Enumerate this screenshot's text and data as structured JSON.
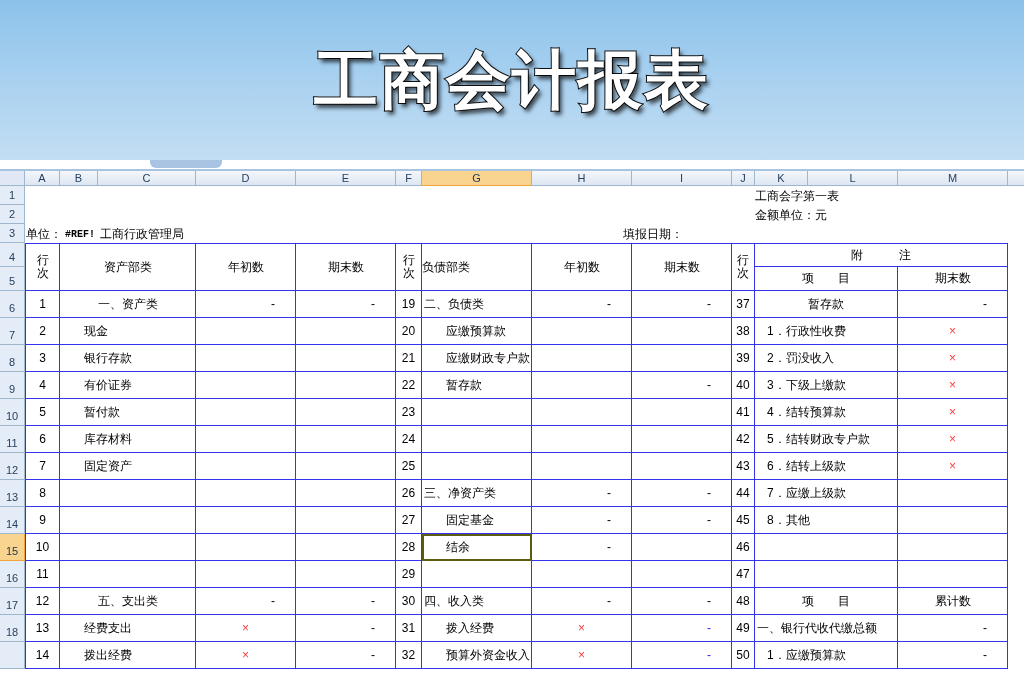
{
  "banner": {
    "title": "工商会计报表"
  },
  "columns": [
    {
      "label": "A",
      "selected": false
    },
    {
      "label": "B",
      "selected": false
    },
    {
      "label": "C",
      "selected": false
    },
    {
      "label": "D",
      "selected": false
    },
    {
      "label": "E",
      "selected": false
    },
    {
      "label": "F",
      "selected": false
    },
    {
      "label": "G",
      "selected": true
    },
    {
      "label": "H",
      "selected": false
    },
    {
      "label": "I",
      "selected": false
    },
    {
      "label": "J",
      "selected": false
    },
    {
      "label": "K",
      "selected": false
    },
    {
      "label": "L",
      "selected": false
    },
    {
      "label": "M",
      "selected": false
    }
  ],
  "row_headers": [
    {
      "label": "1",
      "selected": false
    },
    {
      "label": "2",
      "selected": false
    },
    {
      "label": "3",
      "selected": false
    },
    {
      "label": "4",
      "selected": false
    },
    {
      "label": "5",
      "selected": false
    },
    {
      "label": "6",
      "selected": false
    },
    {
      "label": "7",
      "selected": false
    },
    {
      "label": "8",
      "selected": false
    },
    {
      "label": "9",
      "selected": false
    },
    {
      "label": "10",
      "selected": false
    },
    {
      "label": "11",
      "selected": false
    },
    {
      "label": "12",
      "selected": false
    },
    {
      "label": "13",
      "selected": false
    },
    {
      "label": "14",
      "selected": false
    },
    {
      "label": "15",
      "selected": true
    },
    {
      "label": "16",
      "selected": false
    },
    {
      "label": "17",
      "selected": false
    },
    {
      "label": "18",
      "selected": false
    }
  ],
  "form_code": "工商会字第一表",
  "amount_unit": "金额单位：元",
  "report_date": "填报日期：",
  "unit_label": "单位：",
  "unit_ref": "#REF!",
  "unit_name": "工商行政管理局",
  "headers": {
    "left_no": "行次",
    "left_item": "资产部类",
    "left_start": "年初数",
    "left_end": "期末数",
    "middle_no": "行次",
    "middle_item": "负债部类",
    "middle_start": "年初数",
    "middle_end": "期末数",
    "right_no": "行次",
    "notes": "附　　　注",
    "right_item": "项　　目",
    "right_value": "期末数"
  },
  "rows": [
    {
      "left": {
        "no": "1",
        "item": {
          "text": "一、资产类",
          "kind": "heading"
        },
        "start": {
          "text": "-",
          "kind": "number"
        },
        "end": {
          "text": "-",
          "kind": "number"
        }
      },
      "middle": {
        "no": "19",
        "item": {
          "text": "二、负债类",
          "kind": "section"
        },
        "start": {
          "text": "-",
          "kind": "number"
        },
        "end": {
          "text": "-",
          "kind": "number"
        }
      },
      "right": {
        "no": "37",
        "item": {
          "text": "暂存款",
          "kind": "heading"
        },
        "value": {
          "text": "-",
          "kind": "number"
        }
      }
    },
    {
      "left": {
        "no": "2",
        "item": {
          "text": "现金",
          "kind": "item"
        }
      },
      "middle": {
        "no": "20",
        "item": {
          "text": "应缴预算款",
          "kind": "item"
        }
      },
      "right": {
        "no": "38",
        "item": {
          "text": "1．行政性收费",
          "kind": "item"
        },
        "value": {
          "text": "×",
          "kind": "error"
        }
      }
    },
    {
      "left": {
        "no": "3",
        "item": {
          "text": "银行存款",
          "kind": "item"
        }
      },
      "middle": {
        "no": "21",
        "item": {
          "text": "应缴财政专户款",
          "kind": "item"
        }
      },
      "right": {
        "no": "39",
        "item": {
          "text": "2．罚没收入",
          "kind": "item"
        },
        "value": {
          "text": "×",
          "kind": "error"
        }
      }
    },
    {
      "left": {
        "no": "4",
        "item": {
          "text": "有价证券",
          "kind": "item"
        }
      },
      "middle": {
        "no": "22",
        "item": {
          "text": "暂存款",
          "kind": "item"
        },
        "end": {
          "text": "-",
          "kind": "number"
        }
      },
      "right": {
        "no": "40",
        "item": {
          "text": "3．下级上缴款",
          "kind": "item"
        },
        "value": {
          "text": "×",
          "kind": "error"
        }
      }
    },
    {
      "left": {
        "no": "5",
        "item": {
          "text": "暂付款",
          "kind": "item"
        }
      },
      "middle": {
        "no": "23"
      },
      "right": {
        "no": "41",
        "item": {
          "text": "4．结转预算款",
          "kind": "item"
        },
        "value": {
          "text": "×",
          "kind": "error"
        }
      }
    },
    {
      "left": {
        "no": "6",
        "item": {
          "text": "库存材料",
          "kind": "item"
        }
      },
      "middle": {
        "no": "24"
      },
      "right": {
        "no": "42",
        "item": {
          "text": "5．结转财政专户款",
          "kind": "item"
        },
        "value": {
          "text": "×",
          "kind": "error"
        }
      }
    },
    {
      "left": {
        "no": "7",
        "item": {
          "text": "固定资产",
          "kind": "item"
        }
      },
      "middle": {
        "no": "25"
      },
      "right": {
        "no": "43",
        "item": {
          "text": "6．结转上级款",
          "kind": "item"
        },
        "value": {
          "text": "×",
          "kind": "error"
        }
      }
    },
    {
      "left": {
        "no": "8"
      },
      "middle": {
        "no": "26",
        "item": {
          "text": "三、净资产类",
          "kind": "section"
        },
        "start": {
          "text": "-",
          "kind": "number"
        },
        "end": {
          "text": "-",
          "kind": "number"
        }
      },
      "right": {
        "no": "44",
        "item": {
          "text": "7．应缴上级款",
          "kind": "item"
        }
      }
    },
    {
      "left": {
        "no": "9"
      },
      "middle": {
        "no": "27",
        "item": {
          "text": "固定基金",
          "kind": "item"
        },
        "start": {
          "text": "-",
          "kind": "number"
        },
        "end": {
          "text": "-",
          "kind": "number"
        }
      },
      "right": {
        "no": "45",
        "item": {
          "text": "8．其他",
          "kind": "item"
        }
      }
    },
    {
      "left": {
        "no": "10"
      },
      "middle": {
        "no": "28",
        "item": {
          "text": "结余",
          "kind": "item"
        },
        "start": {
          "text": "-",
          "kind": "number"
        }
      },
      "right": {
        "no": "46"
      }
    },
    {
      "left": {
        "no": "11"
      },
      "middle": {
        "no": "29"
      },
      "right": {
        "no": "47"
      }
    },
    {
      "left": {
        "no": "12",
        "item": {
          "text": "五、支出类",
          "kind": "heading"
        },
        "start": {
          "text": "-",
          "kind": "number"
        },
        "end": {
          "text": "-",
          "kind": "number"
        }
      },
      "middle": {
        "no": "30",
        "item": {
          "text": "四、收入类",
          "kind": "section"
        },
        "start": {
          "text": "-",
          "kind": "number"
        },
        "end": {
          "text": "-",
          "kind": "number"
        }
      },
      "right": {
        "no": "48",
        "item": {
          "text": "项　　目",
          "kind": "heading"
        },
        "value": {
          "text": "累计数",
          "kind": "label"
        }
      }
    },
    {
      "left": {
        "no": "13",
        "item": {
          "text": "经费支出",
          "kind": "item"
        },
        "start": {
          "text": "×",
          "kind": "error"
        },
        "end": {
          "text": "-",
          "kind": "number"
        }
      },
      "middle": {
        "no": "31",
        "item": {
          "text": "拨入经费",
          "kind": "item"
        },
        "start": {
          "text": "×",
          "kind": "error"
        },
        "end": {
          "text": "-",
          "kind": "link"
        }
      },
      "right": {
        "no": "49",
        "item": {
          "text": "一、银行代收代缴总额",
          "kind": "section"
        },
        "value": {
          "text": "-",
          "kind": "number"
        }
      }
    },
    {
      "left": {
        "no": "14",
        "item": {
          "text": "拨出经费",
          "kind": "item"
        },
        "start": {
          "text": "×",
          "kind": "error"
        },
        "end": {
          "text": "-",
          "kind": "number"
        }
      },
      "middle": {
        "no": "32",
        "item": {
          "text": "预算外资金收入",
          "kind": "item"
        },
        "start": {
          "text": "×",
          "kind": "error"
        },
        "end": {
          "text": "-",
          "kind": "link"
        }
      },
      "right": {
        "no": "50",
        "item": {
          "text": "1．应缴预算款",
          "kind": "item"
        },
        "value": {
          "text": "-",
          "kind": "number"
        }
      }
    }
  ]
}
